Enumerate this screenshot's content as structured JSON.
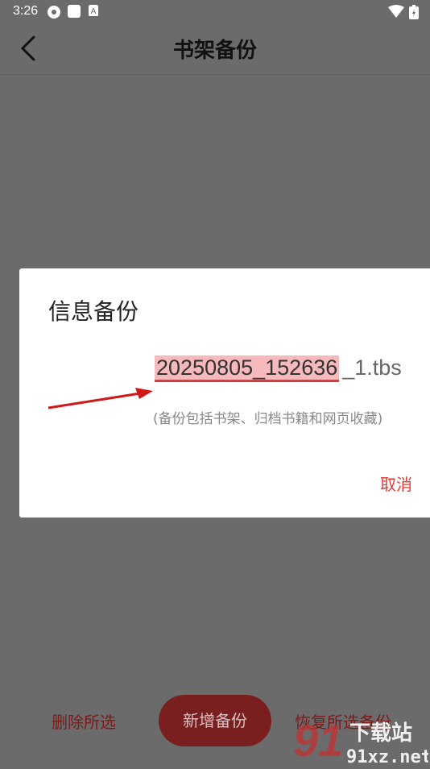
{
  "status_bar": {
    "time": "3:26"
  },
  "app_bar": {
    "title": "书架备份"
  },
  "dialog": {
    "title": "信息备份",
    "filename_highlight": "20250805_152636",
    "filename_suffix": "_1.tbs",
    "hint": "(备份包括书架、归档书籍和网页收藏)",
    "cancel_label": "取消"
  },
  "bottom_bar": {
    "delete_label": "删除所选",
    "new_label": "新增备份",
    "restore_label": "恢复所选备份"
  },
  "watermark": {
    "brand": "下载站",
    "domain": "91xz.net",
    "number": "91"
  },
  "colors": {
    "accent": "#e53935",
    "dim_overlay": "#6b6b6b",
    "button_dark": "#7a1f1f"
  }
}
